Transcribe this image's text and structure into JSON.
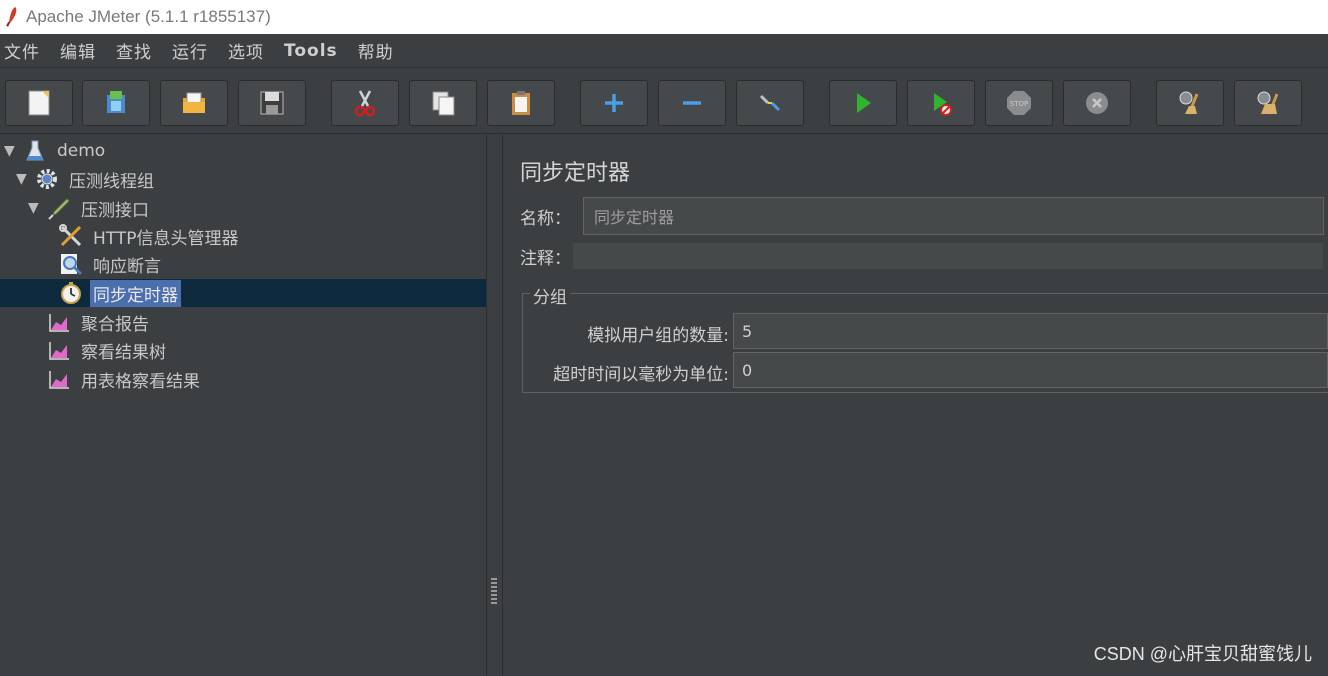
{
  "window": {
    "title": "Apache JMeter (5.1.1 r1855137)"
  },
  "menu": [
    "文件",
    "编辑",
    "查找",
    "运行",
    "选项",
    "Tools",
    "帮助"
  ],
  "toolbar": [
    {
      "name": "new-icon"
    },
    {
      "name": "templates-icon"
    },
    {
      "name": "open-icon"
    },
    {
      "name": "save-icon"
    },
    {
      "name": "cut-icon"
    },
    {
      "name": "copy-icon"
    },
    {
      "name": "paste-icon"
    },
    {
      "name": "expand-icon"
    },
    {
      "name": "collapse-icon"
    },
    {
      "name": "toggle-icon"
    },
    {
      "name": "start-icon"
    },
    {
      "name": "start-no-pause-icon"
    },
    {
      "name": "stop-icon"
    },
    {
      "name": "shutdown-icon"
    },
    {
      "name": "clear-icon"
    },
    {
      "name": "clear-all-icon"
    }
  ],
  "tree": {
    "items": [
      {
        "label": "demo",
        "icon": "flask-icon",
        "expanded": true
      },
      {
        "label": "压测线程组",
        "icon": "gear-icon",
        "expanded": true
      },
      {
        "label": "压测接口",
        "icon": "pipette-icon",
        "expanded": true
      },
      {
        "label": "HTTP信息头管理器",
        "icon": "tools-icon"
      },
      {
        "label": "响应断言",
        "icon": "magnifier-icon"
      },
      {
        "label": "同步定时器",
        "icon": "stopwatch-icon",
        "selected": true
      },
      {
        "label": "聚合报告",
        "icon": "graph-icon"
      },
      {
        "label": "察看结果树",
        "icon": "graph-icon"
      },
      {
        "label": "用表格察看结果",
        "icon": "graph-icon"
      }
    ]
  },
  "panel": {
    "title": "同步定时器",
    "name_label": "名称：",
    "name_value": "同步定时器",
    "comment_label": "注释：",
    "comment_value": "",
    "group_legend": "分组",
    "users_label": "模拟用户组的数量:",
    "users_value": "5",
    "timeout_label": "超时时间以毫秒为单位:",
    "timeout_value": "0"
  },
  "watermark": "CSDN @心肝宝贝甜蜜饯儿"
}
